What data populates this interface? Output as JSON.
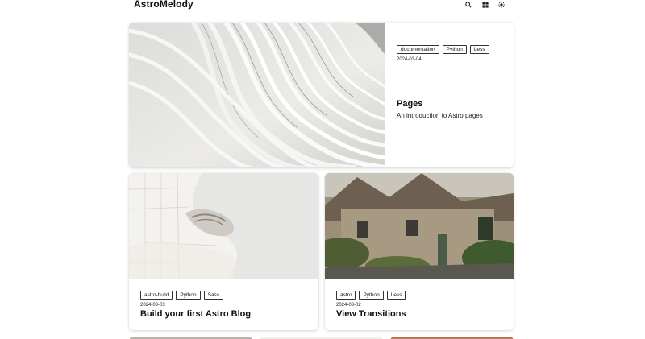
{
  "header": {
    "brand": "AstroMelody",
    "icons": [
      "search-icon",
      "grid-icon",
      "sun-icon"
    ]
  },
  "posts": [
    {
      "tags": [
        "documentation",
        "Python",
        "Less"
      ],
      "date": "2024-03-04",
      "title": "Pages",
      "description": "An introduction to Astro pages"
    },
    {
      "tags": [
        "astro-build",
        "Python",
        "Sass"
      ],
      "date": "2024-03-03",
      "title": "Build your first Astro Blog"
    },
    {
      "tags": [
        "astro",
        "Python",
        "Less"
      ],
      "date": "2024-03-02",
      "title": "View Transitions"
    }
  ]
}
